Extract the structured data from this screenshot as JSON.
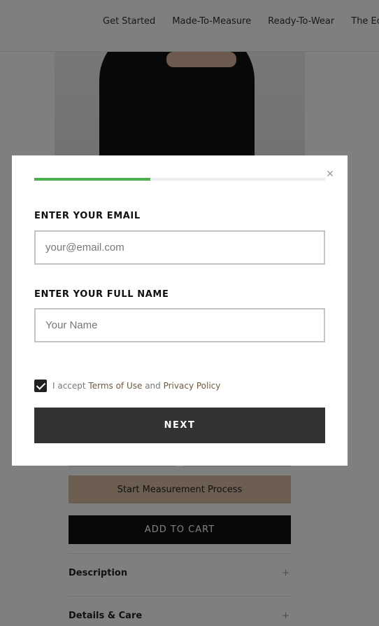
{
  "header": {
    "nav": [
      "Get Started",
      "Made-To-Measure",
      "Ready-To-Wear",
      "The Edit"
    ]
  },
  "product": {
    "measure_button": "Start Measurement Process",
    "cart_button": "ADD TO CART",
    "accordion": [
      {
        "label": "Description",
        "icon": "+"
      },
      {
        "label": "Details & Care",
        "icon": "+"
      }
    ]
  },
  "modal": {
    "progress_fraction": 0.4,
    "close_icon": "×",
    "email_label": "ENTER YOUR EMAIL",
    "email_placeholder": "your@email.com",
    "email_value": "",
    "name_label": "ENTER YOUR FULL NAME",
    "name_placeholder": "Your Name",
    "name_value": "",
    "consent": {
      "checked": true,
      "prefix": "I accept ",
      "terms": "Terms of Use",
      "and": " and ",
      "privacy": "Privacy Policy"
    },
    "next_button": "NEXT"
  },
  "colors": {
    "progress": "#4caf50",
    "measure_button_bg": "#d9bca2",
    "next_button_bg": "#333333",
    "link": "#6b5a3e"
  }
}
